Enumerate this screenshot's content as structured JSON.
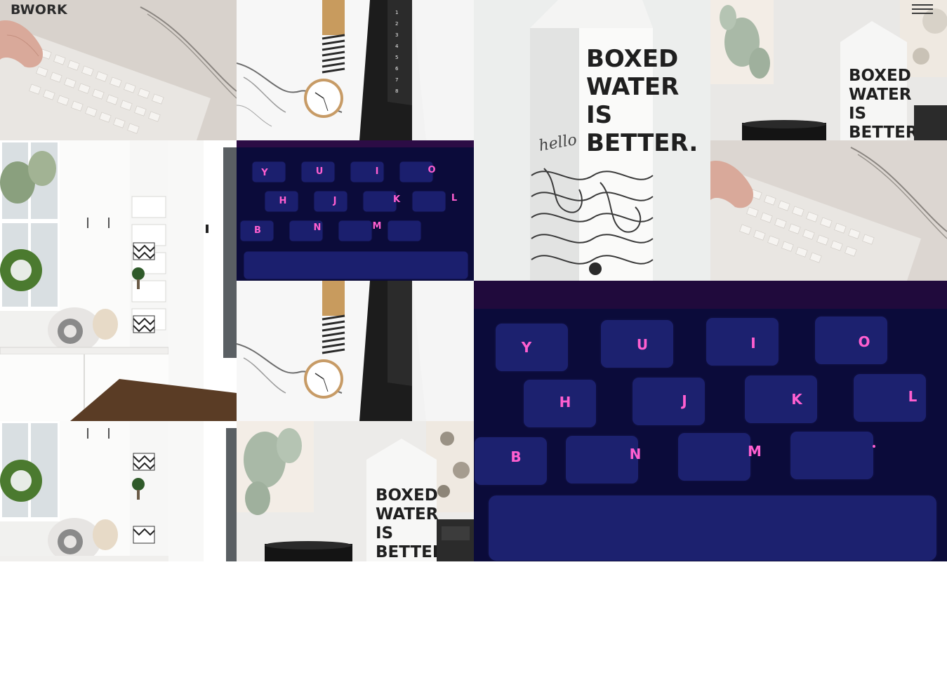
{
  "header": {
    "logo": "BWORK",
    "menu_icon": "hamburger-menu-icon"
  },
  "gallery": {
    "tiles": [
      {
        "subject": "keyboard-typing"
      },
      {
        "subject": "watch-marble"
      },
      {
        "subject": "boxed-water-carton",
        "text_lines": [
          "BOXED",
          "WATER",
          "IS",
          "BETTER."
        ],
        "script": "hello"
      },
      {
        "subject": "boxed-water-cactus",
        "text_lines": [
          "BOXED",
          "WATER",
          "IS",
          "BETTER."
        ]
      },
      {
        "subject": "white-mudroom"
      },
      {
        "subject": "neon-keyboard",
        "keys": [
          "Y",
          "U",
          "I",
          "O",
          "H",
          "J",
          "K",
          "L",
          "B",
          "N",
          "M"
        ]
      },
      {
        "subject": "keyboard-typing"
      },
      {
        "subject": "watch-marble"
      },
      {
        "subject": "neon-keyboard",
        "keys": [
          "Y",
          "U",
          "I",
          "O",
          "H",
          "J",
          "K",
          "L",
          "B",
          "N",
          "M"
        ]
      },
      {
        "subject": "white-mudroom"
      },
      {
        "subject": "boxed-water-cactus",
        "text_lines": [
          "BOXED",
          "WATER",
          "IS",
          "BETTER."
        ]
      }
    ]
  }
}
